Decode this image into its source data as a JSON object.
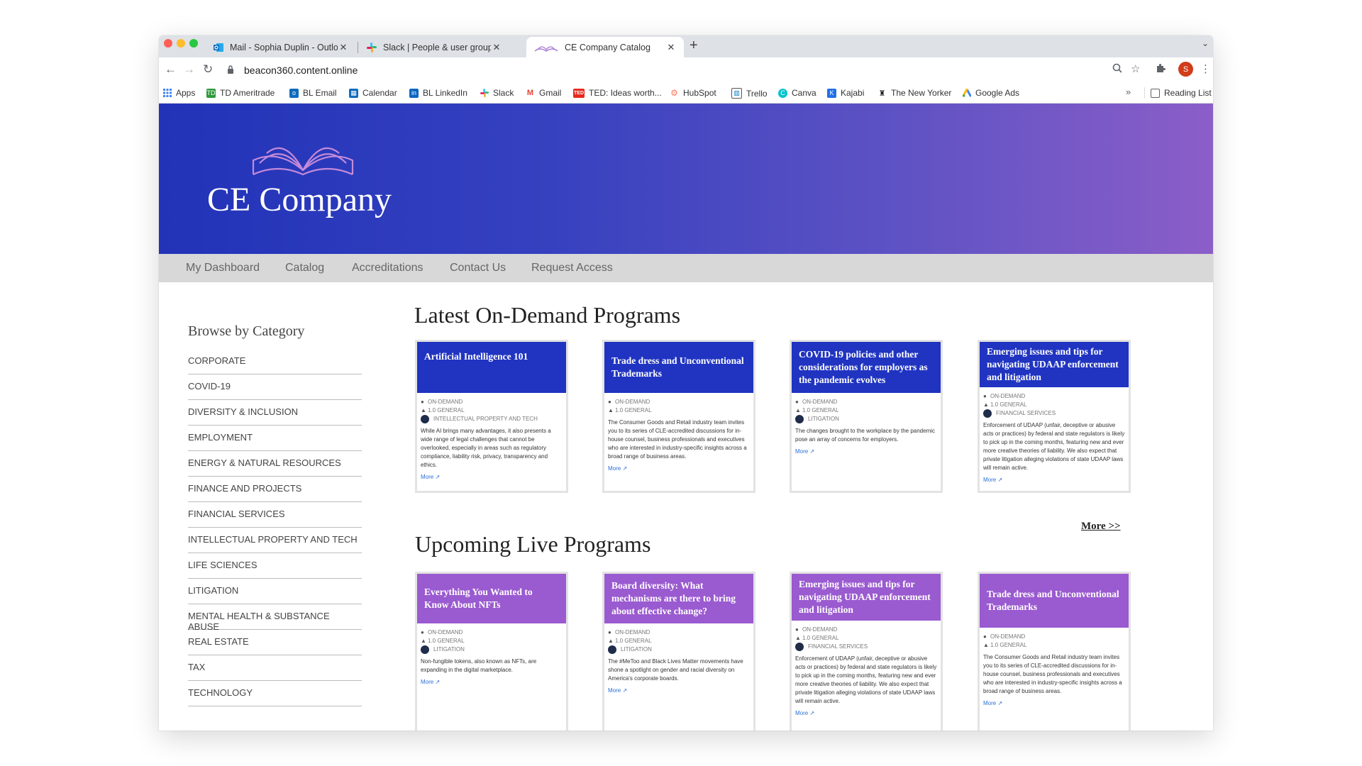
{
  "browser": {
    "tabs": [
      {
        "title": "Mail - Sophia Duplin - Outlook",
        "close": "✕",
        "active": false
      },
      {
        "title": "Slack | People & user groups | ",
        "close": "✕",
        "active": false
      },
      {
        "title": "CE Company Catalog",
        "close": "✕",
        "active": true
      }
    ],
    "new_tab": "+",
    "tab_menu": "⌄",
    "url": "beacon360.content.online",
    "bookmarks": [
      {
        "label": "Apps",
        "icon": "apps-grid-icon",
        "color": "#4285f4"
      },
      {
        "label": "TD Ameritrade",
        "icon": "td-icon",
        "color": "#2e9a3a"
      },
      {
        "label": "BL Email",
        "icon": "outlook-icon",
        "color": "#0f6cbd"
      },
      {
        "label": "Calendar",
        "icon": "calendar-icon",
        "color": "#0f6cbd"
      },
      {
        "label": "BL LinkedIn",
        "icon": "linkedin-icon",
        "color": "#0a66c2"
      },
      {
        "label": "Slack",
        "icon": "slack-icon",
        "color": "#e01e5a"
      },
      {
        "label": "Gmail",
        "icon": "gmail-icon",
        "color": "#ea4335"
      },
      {
        "label": "TED: Ideas worth...",
        "icon": "ted-icon",
        "color": "#e62b1e"
      },
      {
        "label": "HubSpot",
        "icon": "hubspot-icon",
        "color": "#ff7a59"
      },
      {
        "label": "Trello",
        "icon": "trello-icon",
        "color": "#0079bf"
      },
      {
        "label": "Canva",
        "icon": "canva-icon",
        "color": "#00c4cc"
      },
      {
        "label": "Kajabi",
        "icon": "kajabi-icon",
        "color": "#1f6feb"
      },
      {
        "label": "The New Yorker",
        "icon": "new-yorker-icon",
        "color": "#222222"
      },
      {
        "label": "Google Ads",
        "icon": "google-ads-icon",
        "color": "#fbbc04"
      }
    ],
    "bookmarks_more": "»",
    "reading_list": "Reading List",
    "profile_initial": "S"
  },
  "site": {
    "brand": "CE Company",
    "nav": [
      "My Dashboard",
      "Catalog",
      "Accreditations",
      "Contact Us",
      "Request Access"
    ],
    "sidebar_title": "Browse by Category",
    "categories": [
      "CORPORATE",
      "COVID-19",
      "DIVERSITY & INCLUSION",
      "EMPLOYMENT",
      "ENERGY & NATURAL RESOURCES",
      "FINANCE AND PROJECTS",
      "FINANCIAL SERVICES",
      "INTELLECTUAL PROPERTY AND TECH",
      "LIFE SCIENCES",
      "LITIGATION",
      "MENTAL HEALTH & SUBSTANCE ABUSE",
      "REAL ESTATE",
      "TAX",
      "TECHNOLOGY"
    ],
    "on_demand_title": "Latest On-Demand Programs",
    "live_title": "Upcoming Live Programs",
    "more_link": "More >>",
    "on_demand": [
      {
        "title": "Artificial Intelligence 101",
        "mode": "ON-DEMAND",
        "credit": "1.0 GENERAL",
        "topic": "INTELLECTUAL PROPERTY AND TECH",
        "description": "While AI brings many advantages, it also presents a wide range of legal challenges that cannot be overlooked, especially in areas such as regulatory compliance, liability risk, privacy, transparency and ethics.",
        "more": "More"
      },
      {
        "title": "Trade dress and Unconventional Trademarks",
        "mode": "ON-DEMAND",
        "credit": "1.0 GENERAL",
        "topic": "",
        "description": "The Consumer Goods and Retail industry team invites you to its series of CLE-accredited discussions for in-house counsel, business professionals and executives who are interested in industry-specific insights across a broad range of business areas.",
        "more": "More"
      },
      {
        "title": "COVID-19 policies and other considerations for employers as the pandemic evolves",
        "mode": "ON-DEMAND",
        "credit": "1.0 GENERAL",
        "topic": "LITIGATION",
        "description": "The changes brought to the workplace by the pandemic pose an array of concerns for employers.",
        "more": "More"
      },
      {
        "title": "Emerging issues and tips for navigating UDAAP enforcement and litigation",
        "mode": "ON-DEMAND",
        "credit": "1.0 GENERAL",
        "topic": "FINANCIAL SERVICES",
        "description": "Enforcement of UDAAP (unfair, deceptive or abusive acts or practices) by federal and state regulators is likely to pick up in the coming months, featuring new and ever more creative theories of liability. We also expect that private litigation alleging violations of state UDAAP laws will remain active.",
        "more": "More"
      }
    ],
    "live": [
      {
        "title": "Everything You Wanted to Know About NFTs",
        "mode": "ON-DEMAND",
        "credit": "1.0 GENERAL",
        "topic": "LITIGATION",
        "description": "Non-fungible tokens, also known as NFTs, are expanding in the digital marketplace.",
        "more": "More"
      },
      {
        "title": "Board diversity: What mechanisms are there to bring about effective change?",
        "mode": "ON-DEMAND",
        "credit": "1.0 GENERAL",
        "topic": "LITIGATION",
        "description": "The #MeToo and Black Lives Matter movements have shone a spotlight on gender and racial diversity on America's corporate boards.",
        "more": "More"
      },
      {
        "title": "Emerging issues and tips for navigating UDAAP enforcement and litigation",
        "mode": "ON-DEMAND",
        "credit": "1.0 GENERAL",
        "topic": "FINANCIAL SERVICES",
        "description": "Enforcement of UDAAP (unfair, deceptive or abusive acts or practices) by federal and state regulators is likely to pick up in the coming months, featuring new and ever more creative theories of liability. We also expect that private litigation alleging violations of state UDAAP laws will remain active.",
        "more": "More"
      },
      {
        "title": "Trade dress and Unconventional Trademarks",
        "mode": "ON-DEMAND",
        "credit": "1.0 GENERAL",
        "topic": "",
        "description": "The Consumer Goods and Retail industry team invites you to its series of CLE-accredited discussions for in-house counsel, business professionals and executives who are interested in industry-specific insights across a broad range of business areas.",
        "more": "More"
      }
    ]
  },
  "colors": {
    "on_demand_header": "#2034c1",
    "live_header": "#9a5ad0",
    "link": "#2b6fd6"
  }
}
